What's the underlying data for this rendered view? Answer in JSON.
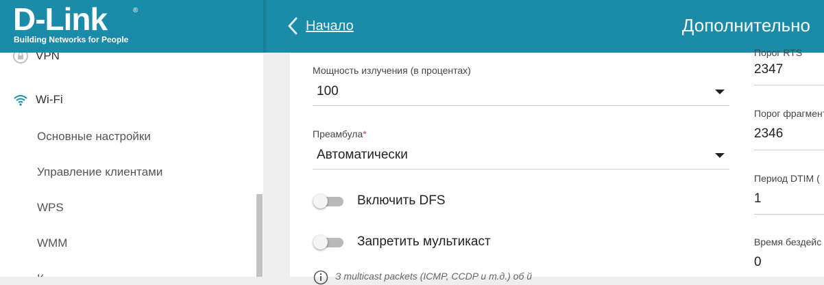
{
  "brand": {
    "logo_text": "D-Link",
    "registered": "®",
    "tagline": "Building Networks for People",
    "color": "#1a8ba8"
  },
  "header": {
    "back_label": "Начало",
    "title": "Дополнительно"
  },
  "sidebar": {
    "items": [
      {
        "label": "VPN",
        "icon": "lock-icon"
      },
      {
        "label": "Wi-Fi",
        "icon": "wifi-icon"
      },
      {
        "label": "Основные настройки"
      },
      {
        "label": "Управление клиентами"
      },
      {
        "label": "WPS"
      },
      {
        "label": "WMM"
      },
      {
        "label": "К"
      }
    ]
  },
  "form": {
    "tx_power": {
      "label": "Мощность излучения (в процентах)",
      "value": "100"
    },
    "preamble": {
      "label": "Преамбула",
      "required_mark": "*",
      "value": "Автоматически"
    },
    "dfs": {
      "label": "Включить DFS",
      "enabled": false
    },
    "multicast": {
      "label": "Запретить мультикаст",
      "enabled": false
    },
    "info_text": "З                              multicast packets (ICMP, CCDP и т.д.)  об                   й"
  },
  "right_column": {
    "rts": {
      "label": "Порог RTS",
      "value": "2347"
    },
    "frag": {
      "label": "Порог фрагмент",
      "value": "2346"
    },
    "dtim": {
      "label": "Период DTIM (",
      "value": "1"
    },
    "idle": {
      "label": "Время бездейс",
      "value": "0"
    }
  }
}
